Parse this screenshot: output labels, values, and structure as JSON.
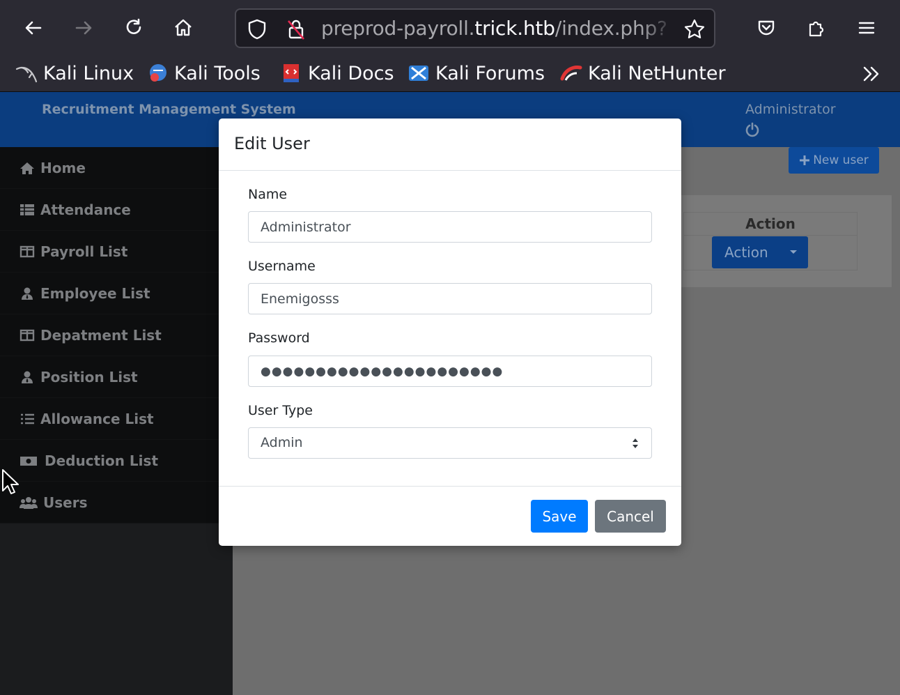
{
  "browser": {
    "url_prefix": "preprod-payroll.",
    "url_host": "trick.htb",
    "url_suffix": "/index.php?",
    "bookmarks": [
      {
        "label": "Kali Linux",
        "icon": "kali-dragon-icon"
      },
      {
        "label": "Kali Tools",
        "icon": "kali-tools-icon"
      },
      {
        "label": "Kali Docs",
        "icon": "kali-docs-icon"
      },
      {
        "label": "Kali Forums",
        "icon": "kali-forums-icon"
      },
      {
        "label": "Kali NetHunter",
        "icon": "kali-nethunter-icon"
      }
    ]
  },
  "app": {
    "title": "Recruitment Management System",
    "user": "Administrator"
  },
  "sidebar": {
    "items": [
      {
        "label": "Home",
        "icon": "home-icon"
      },
      {
        "label": "Attendance",
        "icon": "table-icon"
      },
      {
        "label": "Payroll List",
        "icon": "columns-icon"
      },
      {
        "label": "Employee List",
        "icon": "user-tie-icon"
      },
      {
        "label": "Depatment List",
        "icon": "columns-icon"
      },
      {
        "label": "Position List",
        "icon": "user-tie-icon"
      },
      {
        "label": "Allowance List",
        "icon": "list-icon"
      },
      {
        "label": "Deduction List",
        "icon": "money-bill-icon"
      },
      {
        "label": "Users",
        "icon": "users-icon"
      }
    ]
  },
  "content": {
    "new_user_label": "New user",
    "table_header_action": "Action",
    "action_button_label": "Action"
  },
  "modal": {
    "title": "Edit User",
    "name_label": "Name",
    "name_value": "Administrator",
    "username_label": "Username",
    "username_value": "Enemigosss",
    "password_label": "Password",
    "password_value": "●●●●●●●●●●●●●●●●●●●●●●",
    "user_type_label": "User Type",
    "user_type_value": "Admin",
    "save_label": "Save",
    "cancel_label": "Cancel"
  },
  "colors": {
    "topbar": "#0b3d7f",
    "primary": "#007bff",
    "secondary": "#6c757d",
    "sidebar": "#1b1c1e"
  }
}
